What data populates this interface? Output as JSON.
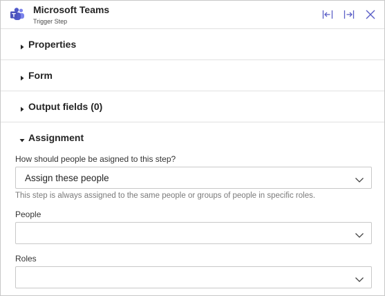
{
  "header": {
    "title": "Microsoft Teams",
    "subtitle": "Trigger Step",
    "app_icon": "teams-logo-icon",
    "buttons": [
      {
        "name": "collapse-left-icon"
      },
      {
        "name": "expand-right-icon"
      },
      {
        "name": "close-icon"
      }
    ]
  },
  "sections": [
    {
      "label": "Properties",
      "expanded": false
    },
    {
      "label": "Form",
      "expanded": false
    },
    {
      "label": "Output fields (0)",
      "expanded": false
    },
    {
      "label": "Assignment",
      "expanded": true
    }
  ],
  "assignment": {
    "question": "How should people be asigned to this step?",
    "selected": "Assign these people",
    "helper": "This step is always assigned to the same people or groups of people in specific roles.",
    "people_label": "People",
    "people_value": "",
    "roles_label": "Roles",
    "roles_value": ""
  },
  "colors": {
    "accent": "#5b5fc7",
    "border": "#c8c8c8",
    "divider": "#e1e1e1",
    "helper_text": "#7a7a7a"
  }
}
